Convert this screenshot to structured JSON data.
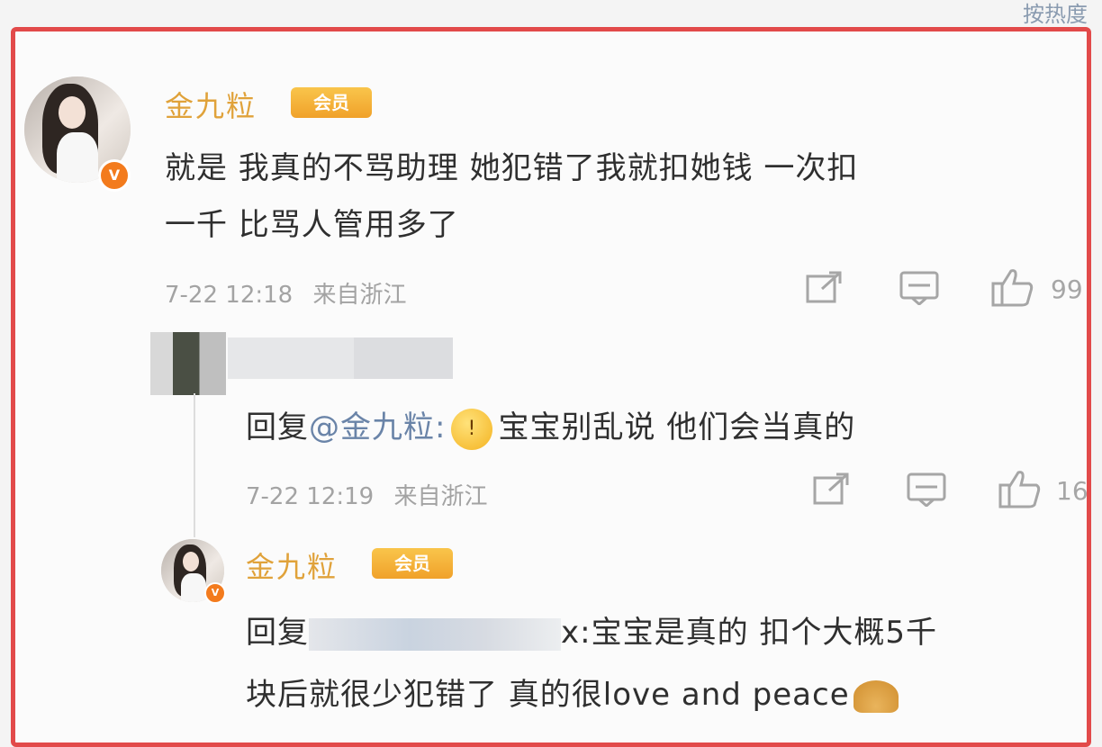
{
  "sort_label": "按热度",
  "comment": {
    "username": "金九粒",
    "vip_label": "会员",
    "text_lines": [
      "就是 我真的不骂助理 她犯错了我就扣她钱 一次扣",
      "一千 比骂人管用多了"
    ],
    "time": "7-22 12:18",
    "location": "来自浙江",
    "like_count": "99",
    "share_icon": "share-icon",
    "comment_icon": "comment-icon",
    "like_icon": "thumbs-up-icon"
  },
  "reply1": {
    "prefix": "回复",
    "mention": "@金九粒:",
    "emoji": "shocked-face-emoji",
    "text": "宝宝别乱说 他们会当真的",
    "time": "7-22 12:19",
    "location": "来自浙江",
    "like_count": "16"
  },
  "reply2": {
    "username": "金九粒",
    "vip_label": "会员",
    "prefix": "回复",
    "text_line1": "x:宝宝是真的 扣个大概5千",
    "text_line2": "块后就很少犯错了 真的很love and peace",
    "emoji": "fortune-cookie-emoji"
  },
  "colors": {
    "frame": "#e24a4a",
    "username": "#e0a23a",
    "mention": "#6a84a8",
    "meta": "#a3a3a3"
  }
}
